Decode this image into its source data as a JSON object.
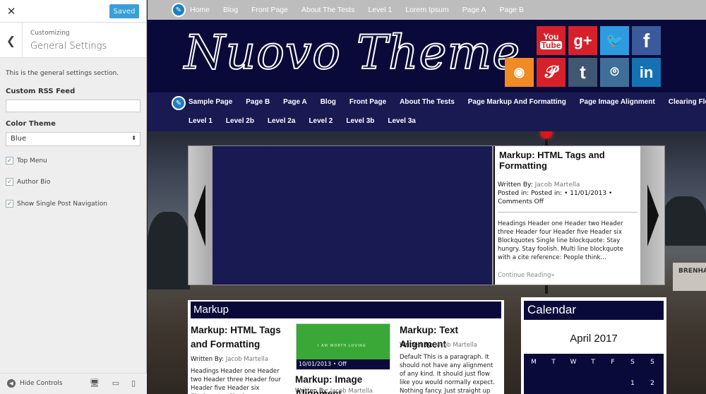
{
  "customizer": {
    "close_icon": "close-icon",
    "saved_label": "Saved",
    "breadcrumb": "Customizing",
    "section_title": "General Settings",
    "description": "This is the general settings section.",
    "rss_label": "Custom RSS Feed",
    "rss_value": "",
    "color_label": "Color Theme",
    "color_value": "Blue",
    "checks": [
      {
        "label": "Top Menu",
        "checked": true
      },
      {
        "label": "Author Bio",
        "checked": true
      },
      {
        "label": "Show Single Post Navigation",
        "checked": true
      }
    ],
    "hide_controls": "Hide Controls",
    "devices": [
      "desktop-icon",
      "tablet-icon",
      "mobile-icon"
    ]
  },
  "preview": {
    "top_menu": [
      "Home",
      "Blog",
      "Front Page",
      "About The Tests",
      "Level 1",
      "Lorem Ipsum",
      "Page A",
      "Page B"
    ],
    "site_title": "Nuovo Theme",
    "social": [
      {
        "name": "youtube",
        "label": "You Tube",
        "color": "#d7212a"
      },
      {
        "name": "google-plus",
        "label": "g+",
        "color": "#d7212a"
      },
      {
        "name": "twitter",
        "label": "🐦",
        "color": "#2e9be0"
      },
      {
        "name": "facebook",
        "label": "f",
        "color": "#3a5a9b"
      },
      {
        "name": "rss",
        "label": "rss",
        "color": "#f08a24"
      },
      {
        "name": "pinterest",
        "label": "P",
        "color": "#d7212a"
      },
      {
        "name": "tumblr",
        "label": "t",
        "color": "#3f5770"
      },
      {
        "name": "instagram",
        "label": "ig",
        "color": "#3f6f98"
      },
      {
        "name": "linkedin",
        "label": "in",
        "color": "#1472b3"
      }
    ],
    "main_menu_row1": [
      "Sample Page",
      "Page B",
      "Page A",
      "Blog",
      "Front Page",
      "About The Tests",
      "Page Markup And Formatting",
      "Page Image Alignment",
      "Clearing Floats"
    ],
    "main_menu_row2": [
      "Level 1",
      "Level 2b",
      "Level 2a",
      "Level 2",
      "Level 3b",
      "Level 3a"
    ],
    "slider": {
      "title": "Markup: HTML Tags and Formatting",
      "written_by": "Written By:",
      "author": "Jacob Martella",
      "posted": "Posted in: Posted in: • 11/01/2013 • Comments Off",
      "excerpt": "Headings Header one Header two Header three Header four Header five Header six Blockquotes Single line blockquote: Stay hungry. Stay foolish. Multi line blockquote with a cite reference: People think…",
      "more": "Continue Reading»"
    },
    "background_sign": "BRENHAM",
    "markup_section": {
      "heading": "Markup",
      "posts": [
        {
          "title": "Markup: HTML Tags and Formatting",
          "written_by": "Written By:",
          "author": "Jacob Martella",
          "excerpt": "Headings Header one Header two Header three Header four Header five Header six Blockquotes Single"
        },
        {
          "title": "Markup: Image Alignment",
          "written_by": "Written By:",
          "author": "Jacob Martella",
          "thumb_caption": "I AM WORTH LOVING",
          "thumb_meta": "10/01/2013 • Off"
        },
        {
          "title": "Markup: Text Alignment",
          "written_by": "Written By:",
          "author": "Jacob Martella",
          "excerpt": "Default This is a paragraph. It should not have any alignment of any kind. It should just flow like you would normally expect. Nothing fancy. Just straight up"
        }
      ]
    },
    "calendar": {
      "heading": "Calendar",
      "month": "April 2017",
      "day_headers": [
        "M",
        "T",
        "W",
        "T",
        "F",
        "S",
        "S"
      ],
      "first_row": [
        "",
        "",
        "",
        "",
        "",
        "1",
        "2"
      ]
    }
  }
}
